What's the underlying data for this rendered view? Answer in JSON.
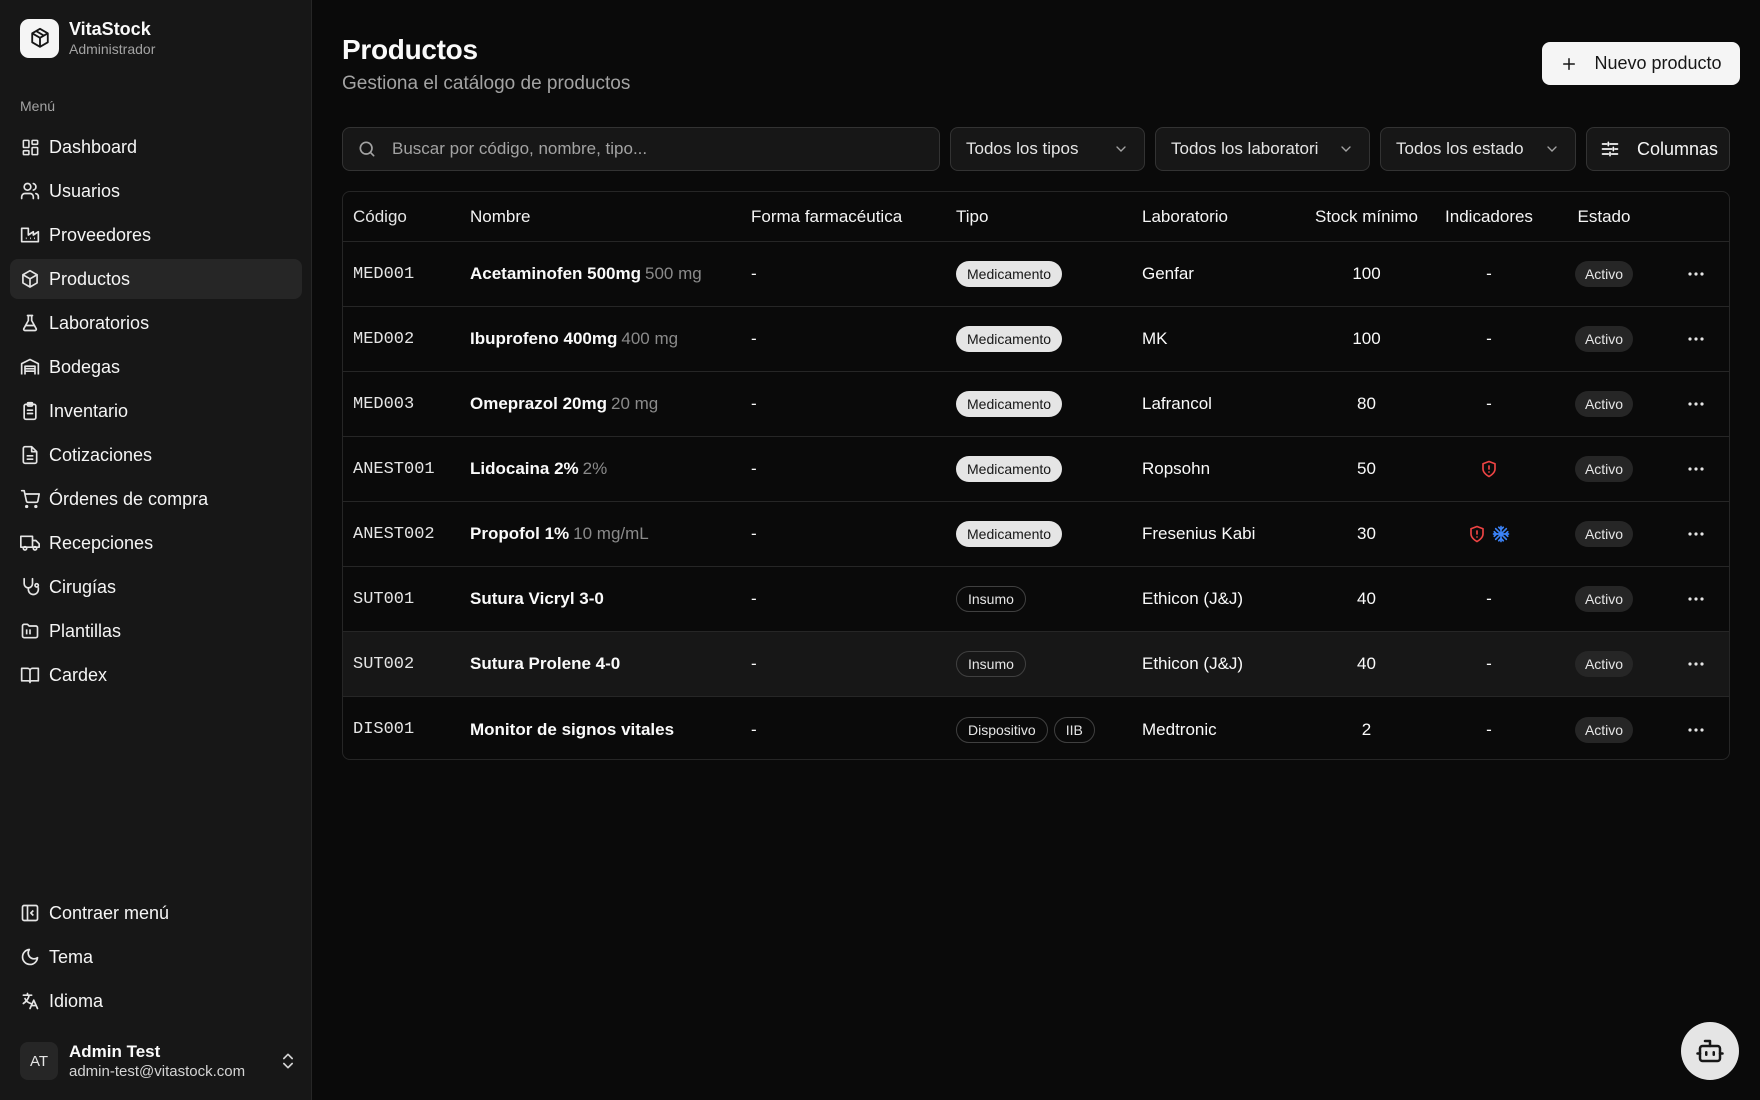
{
  "brand": {
    "name": "VitaStock",
    "role": "Administrador"
  },
  "sidebar": {
    "menu_label": "Menú",
    "items": [
      {
        "label": "Dashboard",
        "icon": "dashboard-icon"
      },
      {
        "label": "Usuarios",
        "icon": "users-icon"
      },
      {
        "label": "Proveedores",
        "icon": "factory-icon"
      },
      {
        "label": "Productos",
        "icon": "package-icon",
        "active": true
      },
      {
        "label": "Laboratorios",
        "icon": "flask-icon"
      },
      {
        "label": "Bodegas",
        "icon": "warehouse-icon"
      },
      {
        "label": "Inventario",
        "icon": "clipboard-icon"
      },
      {
        "label": "Cotizaciones",
        "icon": "document-icon"
      },
      {
        "label": "Órdenes de compra",
        "icon": "cart-icon"
      },
      {
        "label": "Recepciones",
        "icon": "truck-icon"
      },
      {
        "label": "Cirugías",
        "icon": "stethoscope-icon"
      },
      {
        "label": "Plantillas",
        "icon": "folder-icon"
      },
      {
        "label": "Cardex",
        "icon": "book-icon"
      }
    ],
    "bottom": [
      {
        "label": "Contraer menú",
        "icon": "collapse-icon"
      },
      {
        "label": "Tema",
        "icon": "moon-icon"
      },
      {
        "label": "Idioma",
        "icon": "language-icon"
      }
    ],
    "user": {
      "initials": "AT",
      "name": "Admin Test",
      "email": "admin-test@vitastock.com"
    }
  },
  "page": {
    "title": "Productos",
    "subtitle": "Gestiona el catálogo de productos",
    "new_button": "Nuevo producto"
  },
  "filters": {
    "search_placeholder": "Buscar por código, nombre, tipo...",
    "tipo": "Todos los tipos",
    "laboratorio": "Todos los laboratori",
    "estado": "Todos los estado",
    "columns_button": "Columnas"
  },
  "table": {
    "headers": {
      "codigo": "Código",
      "nombre": "Nombre",
      "forma": "Forma farmacéutica",
      "tipo": "Tipo",
      "laboratorio": "Laboratorio",
      "stock": "Stock mínimo",
      "indicadores": "Indicadores",
      "estado": "Estado"
    },
    "rows": [
      {
        "codigo": "MED001",
        "nombre": "Acetaminofen 500mg",
        "dosis": "500 mg",
        "forma": "-",
        "tipo": [
          "Medicamento"
        ],
        "laboratorio": "Genfar",
        "stock": "100",
        "indicadores": "-",
        "estado": "Activo"
      },
      {
        "codigo": "MED002",
        "nombre": "Ibuprofeno 400mg",
        "dosis": "400 mg",
        "forma": "-",
        "tipo": [
          "Medicamento"
        ],
        "laboratorio": "MK",
        "stock": "100",
        "indicadores": "-",
        "estado": "Activo"
      },
      {
        "codigo": "MED003",
        "nombre": "Omeprazol 20mg",
        "dosis": "20 mg",
        "forma": "-",
        "tipo": [
          "Medicamento"
        ],
        "laboratorio": "Lafrancol",
        "stock": "80",
        "indicadores": "-",
        "estado": "Activo"
      },
      {
        "codigo": "ANEST001",
        "nombre": "Lidocaina 2%",
        "dosis": "2%",
        "forma": "-",
        "tipo": [
          "Medicamento"
        ],
        "laboratorio": "Ropsohn",
        "stock": "50",
        "indicadores": "",
        "estado": "Activo"
      },
      {
        "codigo": "ANEST002",
        "nombre": "Propofol 1%",
        "dosis": "10 mg/mL",
        "forma": "-",
        "tipo": [
          "Medicamento"
        ],
        "laboratorio": "Fresenius Kabi",
        "stock": "30",
        "indicadores": "",
        "estado": "Activo"
      },
      {
        "codigo": "SUT001",
        "nombre": "Sutura Vicryl 3-0",
        "dosis": "",
        "forma": "-",
        "tipo": [
          "Insumo"
        ],
        "laboratorio": "Ethicon (J&J)",
        "stock": "40",
        "indicadores": "-",
        "estado": "Activo"
      },
      {
        "codigo": "SUT002",
        "nombre": "Sutura Prolene 4-0",
        "dosis": "",
        "forma": "-",
        "tipo": [
          "Insumo"
        ],
        "laboratorio": "Ethicon (J&J)",
        "stock": "40",
        "indicadores": "-",
        "estado": "Activo"
      },
      {
        "codigo": "DIS001",
        "nombre": "Monitor de signos vitales",
        "dosis": "",
        "forma": "-",
        "tipo": [
          "Dispositivo",
          "IIB"
        ],
        "laboratorio": "Medtronic",
        "stock": "2",
        "indicadores": "-",
        "estado": "Activo"
      }
    ]
  },
  "colors": {
    "background": "#0a0a0a",
    "sidebar": "#171717",
    "controlled_indicator": "#ef4444",
    "cold_chain_indicator": "#3b82f6"
  }
}
